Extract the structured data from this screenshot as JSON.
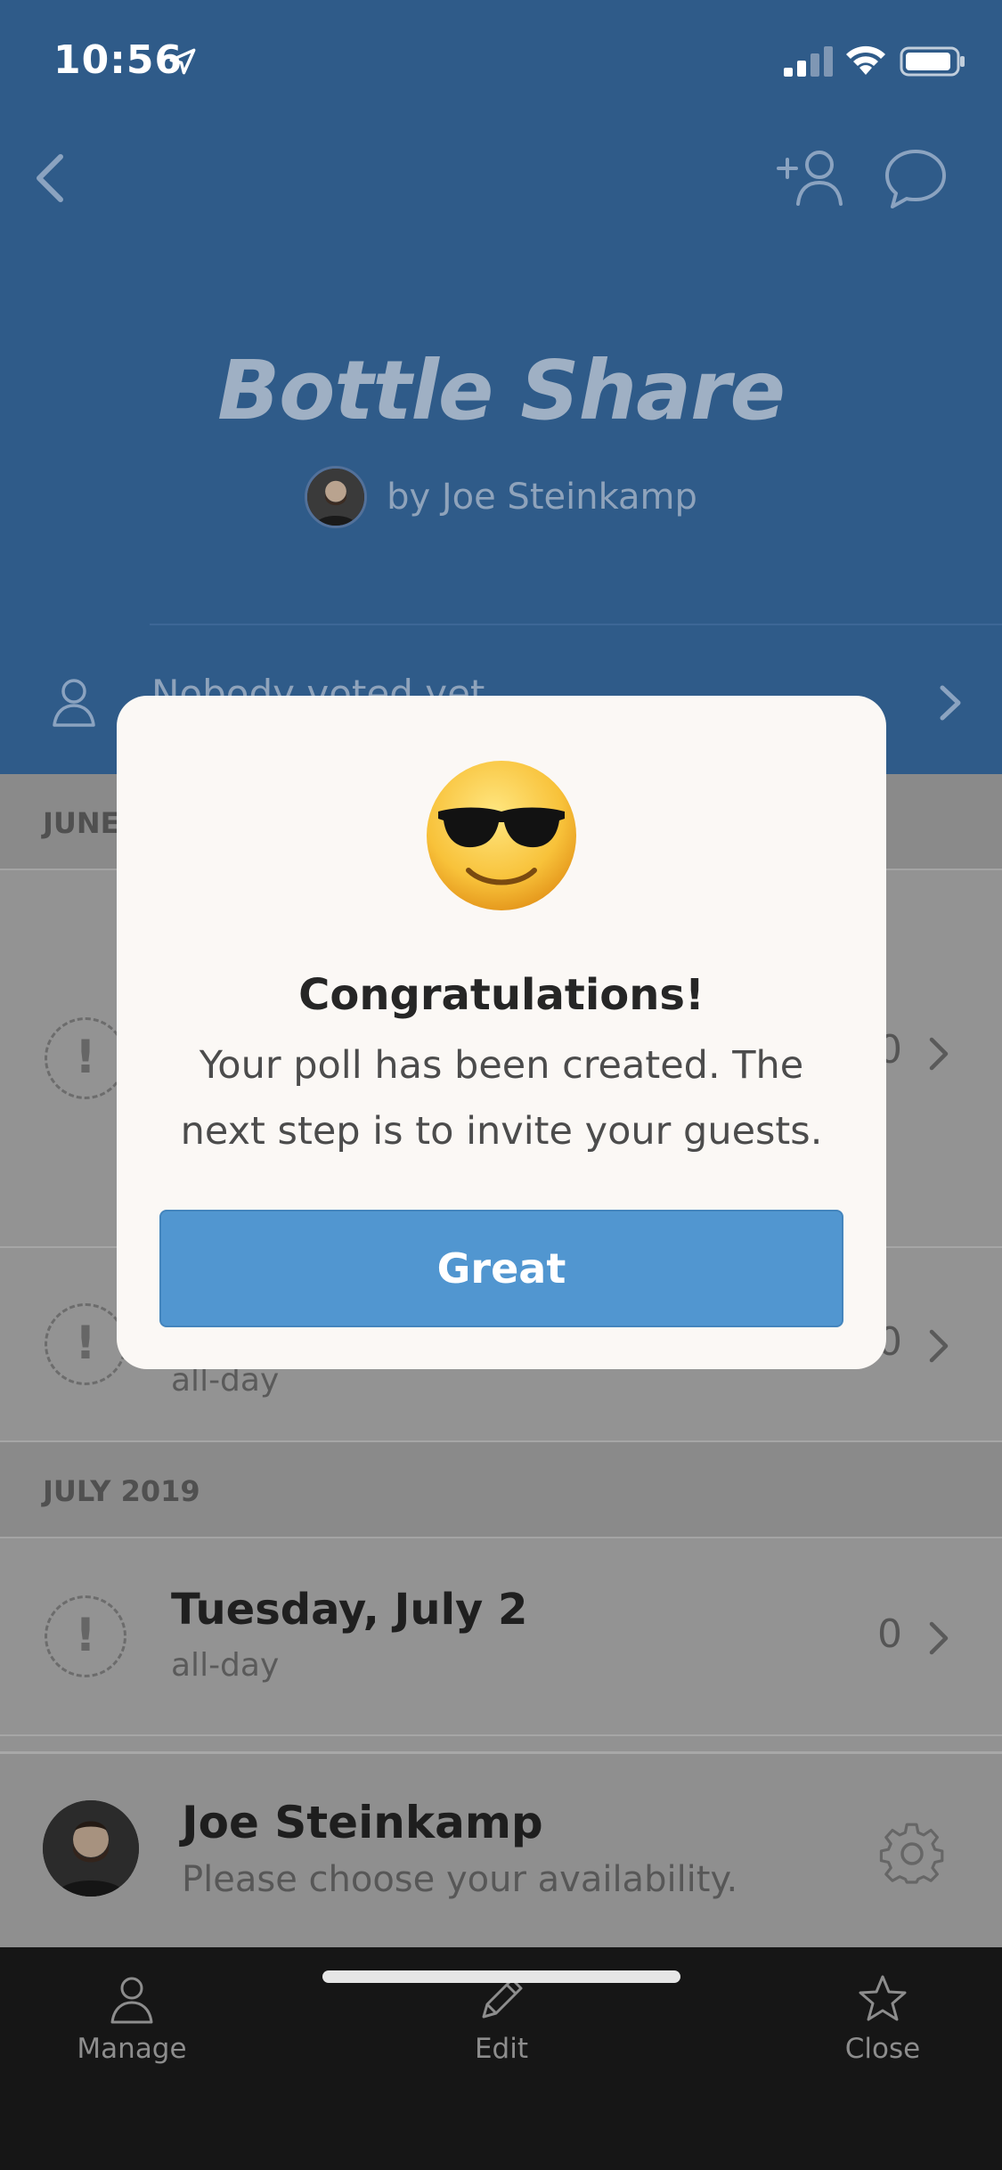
{
  "status_bar": {
    "time": "10:56"
  },
  "header": {
    "title": "Bottle Share",
    "organizer": "by Joe Steinkamp",
    "voters_text": "Nobody voted yet"
  },
  "sections": [
    {
      "label": "JUNE",
      "rows": [
        {
          "date": "",
          "sub": "",
          "count": "0"
        },
        {
          "date": "",
          "sub": "all-day",
          "count": "0"
        }
      ]
    },
    {
      "label": "JULY 2019",
      "rows": [
        {
          "date": "Tuesday, July 2",
          "sub": "all-day",
          "count": "0"
        }
      ]
    }
  ],
  "status_symbol": "!",
  "user_bar": {
    "name": "Joe Steinkamp",
    "status": "Please choose your availability."
  },
  "tabs": [
    {
      "label": "Manage",
      "icon": "person-icon"
    },
    {
      "label": "Edit",
      "icon": "pencil-icon"
    },
    {
      "label": "Close",
      "icon": "star-icon"
    }
  ],
  "modal": {
    "title": "Congratulations!",
    "message": "Your poll has been created. The next step is to invite your guests.",
    "button_label": "Great",
    "emoji": "sunglasses-emoji"
  },
  "colors": {
    "header_bg": "#2f5b89",
    "overlay": "#929292",
    "accent_button": "#5196d0",
    "tab_bar_bg": "#161616"
  }
}
